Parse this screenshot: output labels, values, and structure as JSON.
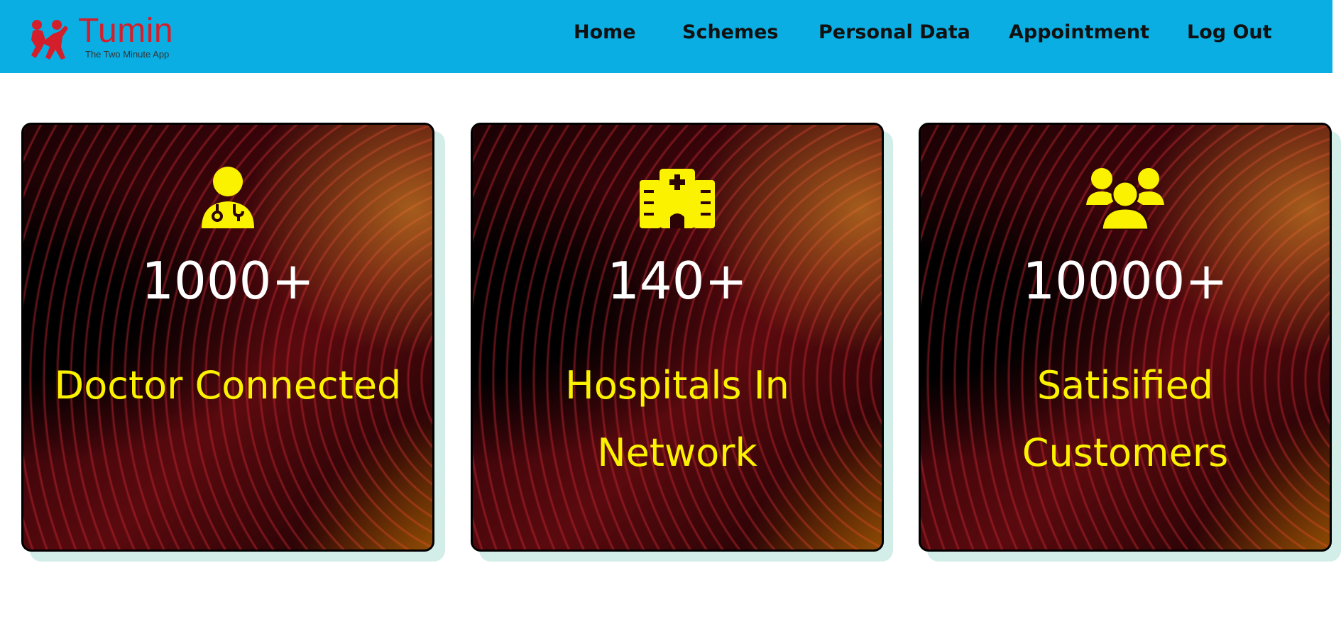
{
  "brand": {
    "name": "Tumin",
    "tagline": "The Two Minute App",
    "color": "#d31f2b"
  },
  "header": {
    "background": "#0aaee3"
  },
  "nav": {
    "items": [
      {
        "label": "Home"
      },
      {
        "label": "Schemes"
      },
      {
        "label": "Personal Data"
      },
      {
        "label": "Appointment"
      },
      {
        "label": "Log Out"
      }
    ]
  },
  "stats": {
    "accent": "#fbf200",
    "cards": [
      {
        "icon": "doctor-icon",
        "number": "1000+",
        "label": "Doctor Connected"
      },
      {
        "icon": "hospital-icon",
        "number": "140+",
        "label": "Hospitals In Network"
      },
      {
        "icon": "users-icon",
        "number": "10000+",
        "label": "Satisified Customers"
      }
    ]
  }
}
